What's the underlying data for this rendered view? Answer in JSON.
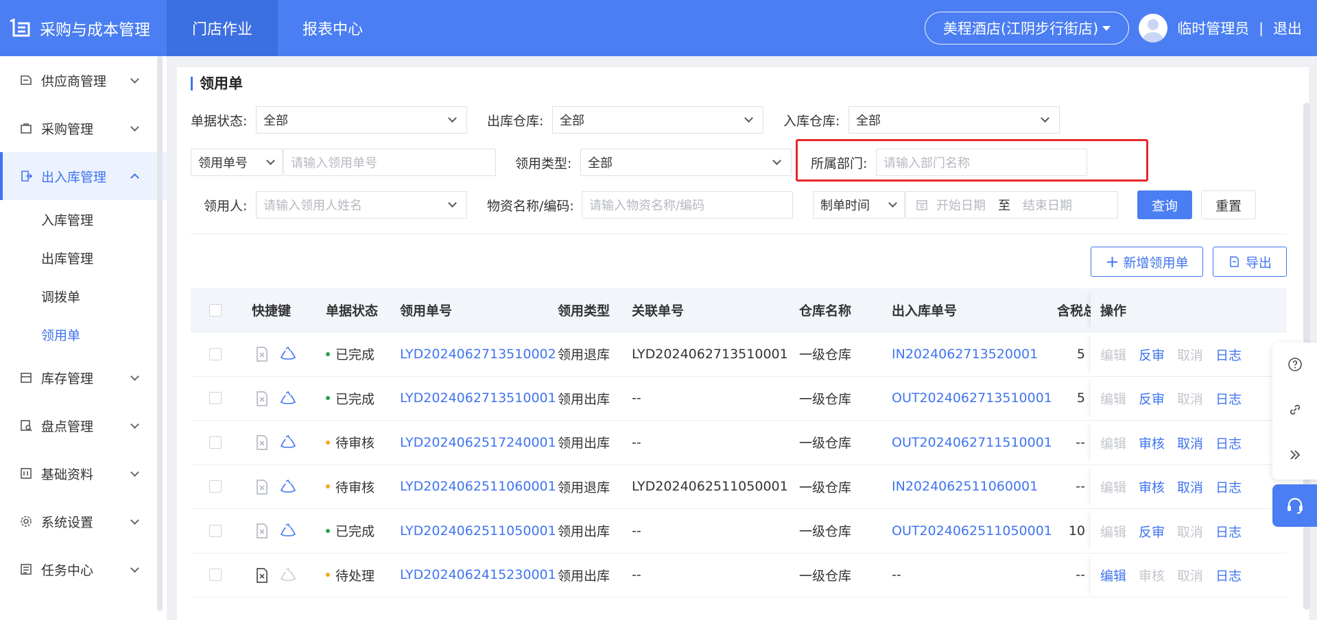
{
  "app": {
    "title": "采购与成本管理",
    "nav_tabs": [
      "门店作业",
      "报表中心"
    ],
    "store_label": "美程酒店(江阴步行街店)",
    "user_name": "临时管理员",
    "separator": "|",
    "logout": "退出",
    "accent_color": "#4a7ef2"
  },
  "sidebar": {
    "items": [
      {
        "label": "供应商管理",
        "icon": "supplier-icon"
      },
      {
        "label": "采购管理",
        "icon": "purchase-icon"
      },
      {
        "label": "出入库管理",
        "icon": "warehouse-io-icon"
      },
      {
        "label": "库存管理",
        "icon": "inventory-icon"
      },
      {
        "label": "盘点管理",
        "icon": "stocktake-icon"
      },
      {
        "label": "基础资料",
        "icon": "basic-data-icon"
      },
      {
        "label": "系统设置",
        "icon": "gear-icon"
      },
      {
        "label": "任务中心",
        "icon": "task-icon"
      }
    ],
    "subitems": [
      "入库管理",
      "出库管理",
      "调拨单",
      "领用单"
    ]
  },
  "page": {
    "title": "领用单"
  },
  "filters": {
    "status_label": "单据状态:",
    "status_value": "全部",
    "out_wh_label": "出库仓库:",
    "out_wh_value": "全部",
    "in_wh_label": "入库仓库:",
    "in_wh_value": "全部",
    "doc_type_value": "领用单号",
    "doc_no_placeholder": "请输入领用单号",
    "use_type_label": "领用类型:",
    "use_type_value": "全部",
    "dept_label": "所属部门:",
    "dept_placeholder": "请输入部门名称",
    "person_label": "领用人:",
    "person_placeholder": "请输入领用人姓名",
    "material_label": "物资名称/编码:",
    "material_placeholder": "请输入物资名称/编码",
    "time_type_value": "制单时间",
    "start_placeholder": "开始日期",
    "range_sep": "至",
    "end_placeholder": "结束日期",
    "query_btn": "查询",
    "reset_btn": "重置"
  },
  "actions": {
    "add_btn": "新增领用单",
    "export_btn": "导出"
  },
  "table": {
    "headers": [
      "快捷键",
      "单据状态",
      "领用单号",
      "领用类型",
      "关联单号",
      "仓库名称",
      "出入库单号",
      "含税总金额",
      "操作"
    ],
    "rows": [
      {
        "status": "已完成",
        "status_color": "#2ba245",
        "doc_no": "LYD2024062713510002",
        "use_type": "领用退库",
        "related_no": "LYD2024062713510001",
        "warehouse": "一级仓库",
        "io_no": "IN2024062713520001",
        "io_link": true,
        "amount": "5",
        "ops": [
          "编辑",
          "反审",
          "取消",
          "日志"
        ],
        "ops_enabled": [
          false,
          true,
          false,
          true
        ],
        "shortcut_active": false
      },
      {
        "status": "已完成",
        "status_color": "#2ba245",
        "doc_no": "LYD2024062713510001",
        "use_type": "领用出库",
        "related_no": "--",
        "warehouse": "一级仓库",
        "io_no": "OUT2024062713510001",
        "io_link": true,
        "amount": "5",
        "ops": [
          "编辑",
          "反审",
          "取消",
          "日志"
        ],
        "ops_enabled": [
          false,
          true,
          false,
          true
        ],
        "shortcut_active": false
      },
      {
        "status": "待审核",
        "status_color": "#f5a623",
        "doc_no": "LYD2024062517240001",
        "use_type": "领用出库",
        "related_no": "--",
        "warehouse": "一级仓库",
        "io_no": "OUT2024062711510001",
        "io_link": true,
        "amount": "--",
        "ops": [
          "编辑",
          "审核",
          "取消",
          "日志"
        ],
        "ops_enabled": [
          false,
          true,
          true,
          true
        ],
        "shortcut_active": false
      },
      {
        "status": "待审核",
        "status_color": "#f5a623",
        "doc_no": "LYD2024062511060001",
        "use_type": "领用退库",
        "related_no": "LYD2024062511050001",
        "warehouse": "一级仓库",
        "io_no": "IN2024062511060001",
        "io_link": true,
        "amount": "--",
        "ops": [
          "编辑",
          "审核",
          "取消",
          "日志"
        ],
        "ops_enabled": [
          false,
          true,
          true,
          true
        ],
        "shortcut_active": false
      },
      {
        "status": "已完成",
        "status_color": "#2ba245",
        "doc_no": "LYD2024062511050001",
        "use_type": "领用出库",
        "related_no": "--",
        "warehouse": "一级仓库",
        "io_no": "OUT2024062511050001",
        "io_link": true,
        "amount": "10",
        "ops": [
          "编辑",
          "反审",
          "取消",
          "日志"
        ],
        "ops_enabled": [
          false,
          true,
          false,
          true
        ],
        "shortcut_active": false
      },
      {
        "status": "待处理",
        "status_color": "#f5a623",
        "doc_no": "LYD2024062415230001",
        "use_type": "领用出库",
        "related_no": "--",
        "warehouse": "一级仓库",
        "io_no": "--",
        "io_link": false,
        "amount": "--",
        "ops": [
          "编辑",
          "审核",
          "取消",
          "日志"
        ],
        "ops_enabled": [
          true,
          false,
          false,
          true
        ],
        "shortcut_active": true
      }
    ]
  },
  "floating_tools": [
    "help-icon",
    "link-icon",
    "collapse-icon",
    "support-icon"
  ]
}
